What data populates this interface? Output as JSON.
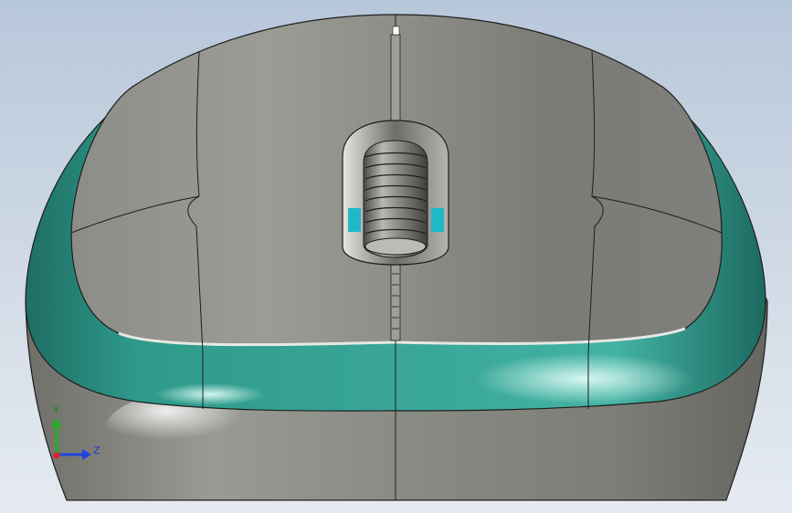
{
  "viewport": {
    "background_top": "#b7c7da",
    "background_bottom": "#e6ebf1"
  },
  "model": {
    "body_color": "#8d8d87",
    "grip_color": "#2e9a8a",
    "top_shell_color": "#8a8a86",
    "scroll_wheel_color": "#9a9a95",
    "edge_color": "#1e1e1e",
    "accent_cyan": "#20b8c6"
  },
  "triad": {
    "y_label": "Y",
    "z_label": "Z",
    "y_color": "#22b022",
    "z_color": "#2244dd",
    "x_color": "#dd2222"
  }
}
